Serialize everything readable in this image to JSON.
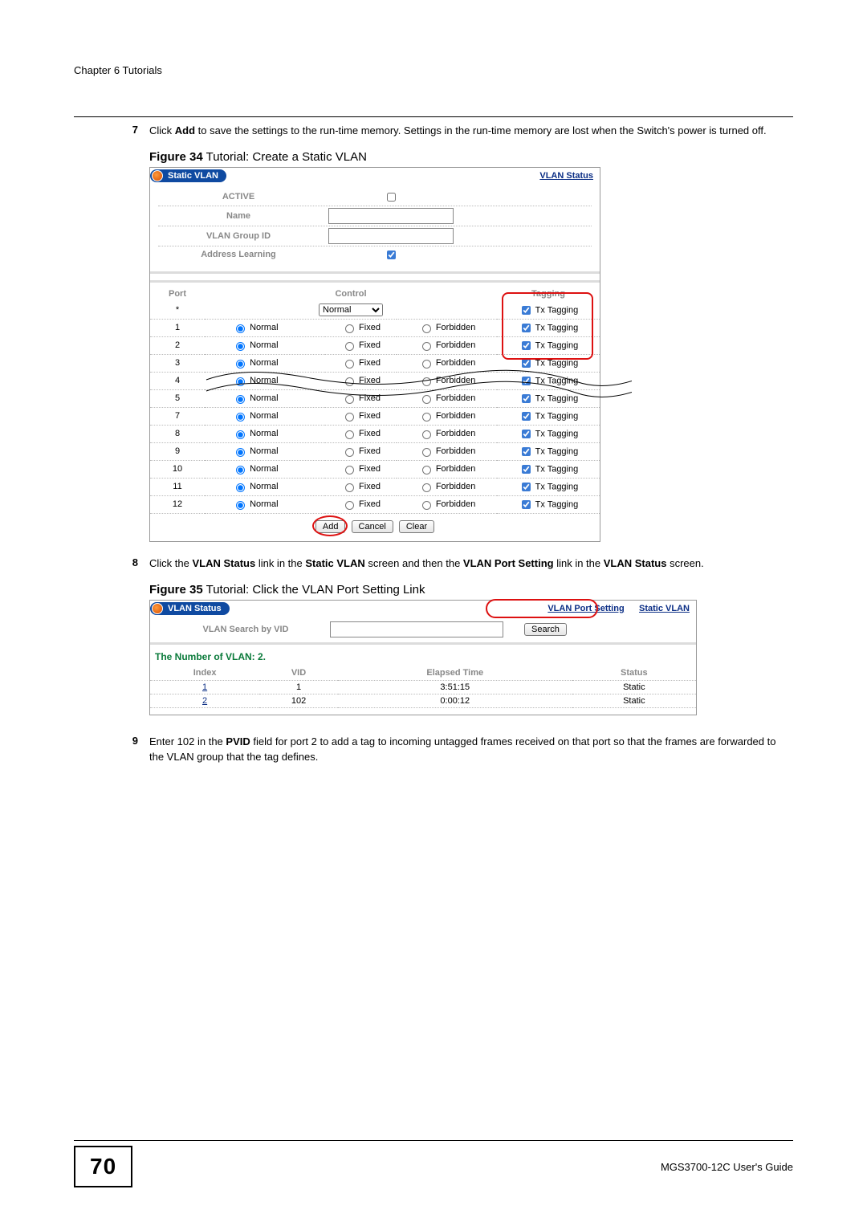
{
  "chapter": "Chapter 6 Tutorials",
  "steps": {
    "s7": {
      "num": "7",
      "text_a": "Click ",
      "bold_a": "Add",
      "text_b": " to save the settings to the run-time memory. Settings in the run-time memory are lost when the Switch's power is turned off."
    },
    "s8": {
      "num": "8",
      "text_a": "Click the ",
      "bold_a": "VLAN Status",
      "text_b": " link in the ",
      "bold_b": "Static VLAN",
      "text_c": " screen and then the ",
      "bold_c": "VLAN Port Setting",
      "text_d": " link in the ",
      "bold_d": "VLAN Status",
      "text_e": " screen."
    },
    "s9": {
      "num": "9",
      "text_a": "Enter 102 in the ",
      "bold_a": "PVID",
      "text_b": " field for port 2 to add a tag to incoming untagged frames received on that port so that the frames are forwarded to the VLAN group that the tag defines."
    }
  },
  "fig34": {
    "caption_bold": "Figure 34",
    "caption_rest": "   Tutorial: Create a Static VLAN",
    "title": "Static VLAN",
    "hdr_link": "VLAN Status",
    "labels": {
      "active": "ACTIVE",
      "name": "Name",
      "group": "VLAN Group ID",
      "addr": "Address Learning"
    },
    "cols": {
      "port": "Port",
      "control": "Control",
      "tagging": "Tagging"
    },
    "dropdown_default": "Normal",
    "row_labels": {
      "normal": "Normal",
      "fixed": "Fixed",
      "forbidden": "Forbidden",
      "tx": "Tx Tagging"
    },
    "ports": [
      "1",
      "2",
      "3",
      "4",
      "5",
      "7",
      "8",
      "9",
      "10",
      "11",
      "12"
    ],
    "buttons": {
      "add": "Add",
      "cancel": "Cancel",
      "clear": "Clear"
    }
  },
  "fig35": {
    "caption_bold": "Figure 35",
    "caption_rest": "   Tutorial: Click the VLAN Port Setting Link",
    "title": "VLAN Status",
    "links": {
      "port_setting": "VLAN Port Setting",
      "static_vlan": "Static VLAN"
    },
    "search_label": "VLAN Search by VID",
    "search_btn": "Search",
    "subhead": "The Number of VLAN: 2.",
    "cols": {
      "index": "Index",
      "vid": "VID",
      "elapsed": "Elapsed Time",
      "status": "Status"
    },
    "rows": [
      {
        "index": "1",
        "vid": "1",
        "elapsed": "3:51:15",
        "status": "Static"
      },
      {
        "index": "2",
        "vid": "102",
        "elapsed": "0:00:12",
        "status": "Static"
      }
    ]
  },
  "footer": {
    "page": "70",
    "guide": "MGS3700-12C User's Guide"
  }
}
